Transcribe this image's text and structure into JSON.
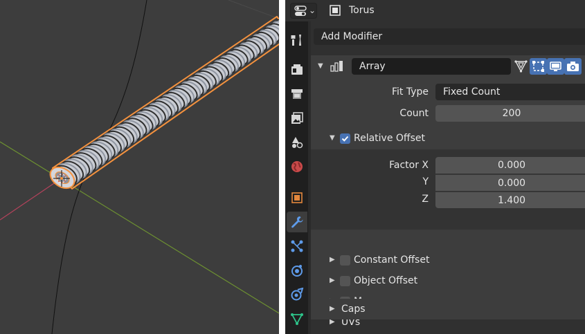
{
  "header": {
    "editor_type_icon": "properties-editor-icon",
    "object_icon": "object-icon",
    "object_name": "Torus"
  },
  "tabs": [
    {
      "name": "tool",
      "icon": "tool-icon",
      "active": false
    },
    {
      "name": "render",
      "icon": "render-icon",
      "active": false
    },
    {
      "name": "output",
      "icon": "output-icon",
      "active": false
    },
    {
      "name": "view-layer",
      "icon": "view-layer-icon",
      "active": false
    },
    {
      "name": "scene",
      "icon": "scene-icon",
      "active": false
    },
    {
      "name": "world",
      "icon": "world-icon",
      "active": false
    },
    {
      "name": "object",
      "icon": "object-icon",
      "active": false
    },
    {
      "name": "modifiers",
      "icon": "wrench-icon",
      "active": true
    },
    {
      "name": "particles",
      "icon": "particles-icon",
      "active": false
    },
    {
      "name": "physics",
      "icon": "physics-icon",
      "active": false
    },
    {
      "name": "constraints",
      "icon": "constraints-icon",
      "active": false
    },
    {
      "name": "data",
      "icon": "mesh-data-icon",
      "active": false
    }
  ],
  "modifiers": {
    "add_label": "Add Modifier",
    "array": {
      "name": "Array",
      "buttons": [
        "edit-cage-icon",
        "edit-mode-icon",
        "realtime-icon",
        "render-icon"
      ],
      "fit_type_label": "Fit Type",
      "fit_type_value": "Fixed Count",
      "count_label": "Count",
      "count_value": "200",
      "relative_offset": {
        "label": "Relative Offset",
        "checked": true,
        "factor_x_label": "Factor X",
        "factor_x_value": "0.000",
        "y_label": "Y",
        "y_value": "0.000",
        "z_label": "Z",
        "z_value": "1.400"
      },
      "constant_offset": {
        "label": "Constant Offset",
        "checked": false
      },
      "object_offset": {
        "label": "Object Offset",
        "checked": false
      },
      "merge": {
        "label": "Merge",
        "checked": false
      },
      "uvs_label": "UVs",
      "caps_label": "Caps"
    }
  },
  "colors": {
    "selection_outline": "#f5923e",
    "x_axis": "#b3425b",
    "y_axis": "#6d9131",
    "checkbox_on": "#4772b3"
  }
}
